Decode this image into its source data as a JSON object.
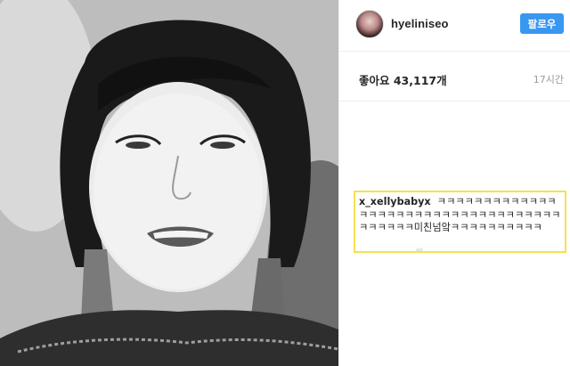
{
  "post": {
    "username": "hyeliniseo",
    "follow_label": "팔로우",
    "likes_text": "좋아요 43,117개",
    "time_ago": "17시간"
  },
  "comment": {
    "user": "x_xellybabyx",
    "text": "ㅋㅋㅋㅋㅋㅋㅋㅋㅋㅋㅋㅋㅋㅋㅋㅋㅋㅋㅋㅋㅋㅋㅋㅋㅋㅋㅋㅋㅋㅋㅋㅋㅋㅋㅋㅋㅋㅋㅋㅋㅋ미친넘앜ㅋㅋㅋㅋㅋㅋㅋㅋㅋㅋ"
  },
  "colors": {
    "follow_button": "#3897f0",
    "highlight_border": "#f4e24e",
    "muted_text": "#999999"
  }
}
